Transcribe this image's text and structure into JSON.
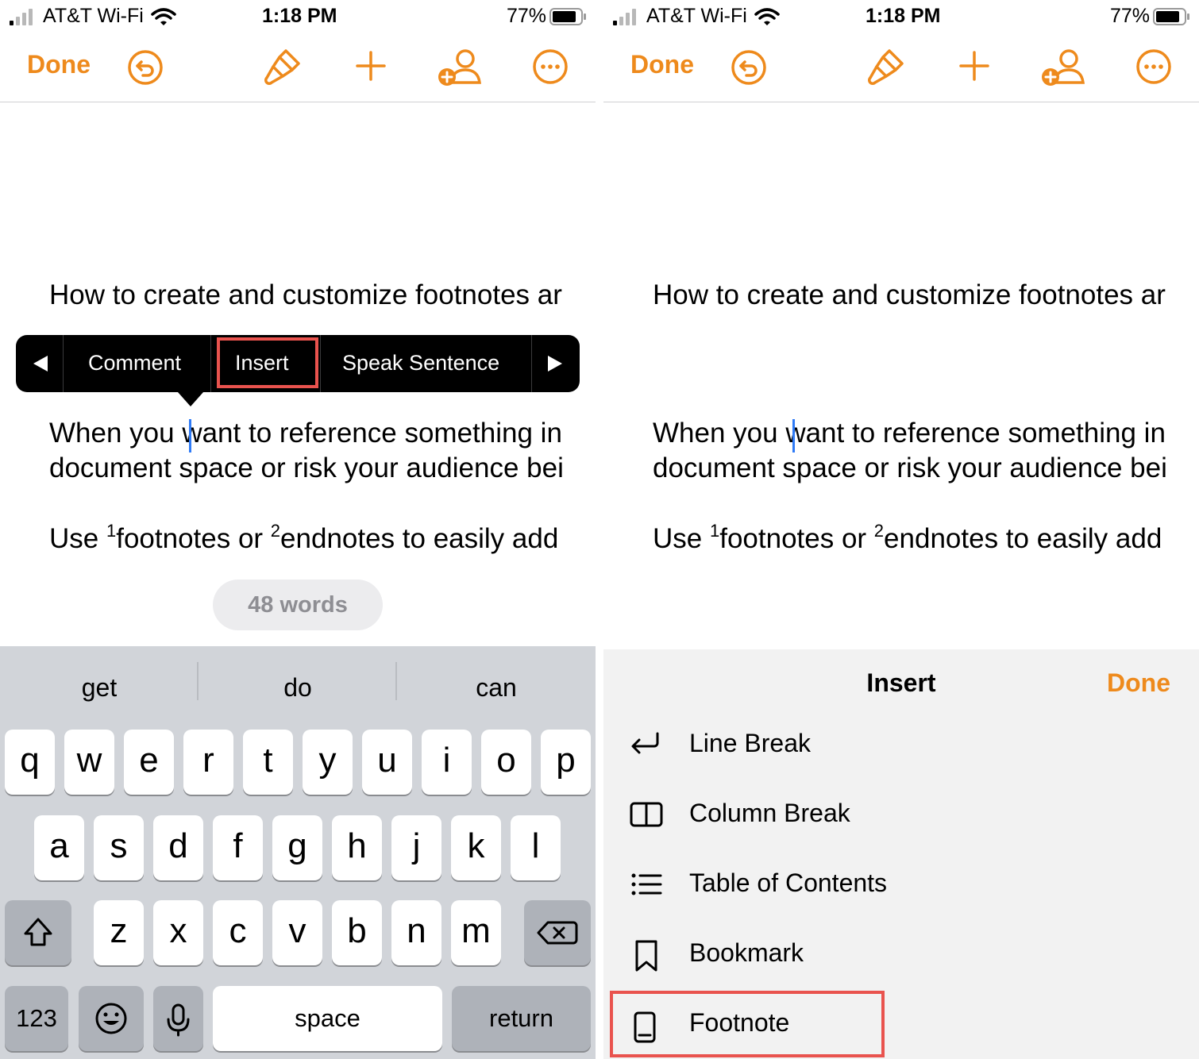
{
  "status": {
    "carrier": "AT&T Wi-Fi",
    "time": "1:18 PM",
    "battery": "77%"
  },
  "toolbar": {
    "done_label": "Done",
    "icons": [
      "undo-icon",
      "format-brush-icon",
      "plus-icon",
      "collaborate-icon",
      "more-icon"
    ],
    "accent_color": "#ee8a1c"
  },
  "document": {
    "title_line": "How to create and customize footnotes ar",
    "para1_line1_before": "When you ",
    "para1_line1_after": "want to reference something in",
    "para1_line2": "document space or risk your audience bei",
    "para2_a": "Use ",
    "para2_fn1": "1",
    "para2_b": "footnotes or ",
    "para2_fn2": "2",
    "para2_c": "endnotes to easily add"
  },
  "context_menu": {
    "items": [
      "Comment",
      "Insert",
      "Speak Sentence"
    ],
    "highlighted": "Insert"
  },
  "word_count": "48 words",
  "keyboard": {
    "suggestions": [
      "get",
      "do",
      "can"
    ],
    "row1": [
      "q",
      "w",
      "e",
      "r",
      "t",
      "y",
      "u",
      "i",
      "o",
      "p"
    ],
    "row2": [
      "a",
      "s",
      "d",
      "f",
      "g",
      "h",
      "j",
      "k",
      "l"
    ],
    "row3": [
      "z",
      "x",
      "c",
      "v",
      "b",
      "n",
      "m"
    ],
    "numbers_label": "123",
    "space_label": "space",
    "return_label": "return"
  },
  "insert_sheet": {
    "title": "Insert",
    "done_label": "Done",
    "items": [
      "Line Break",
      "Column Break",
      "Table of Contents",
      "Bookmark",
      "Footnote"
    ],
    "highlighted": "Footnote"
  },
  "highlight_color": "#e9534e"
}
